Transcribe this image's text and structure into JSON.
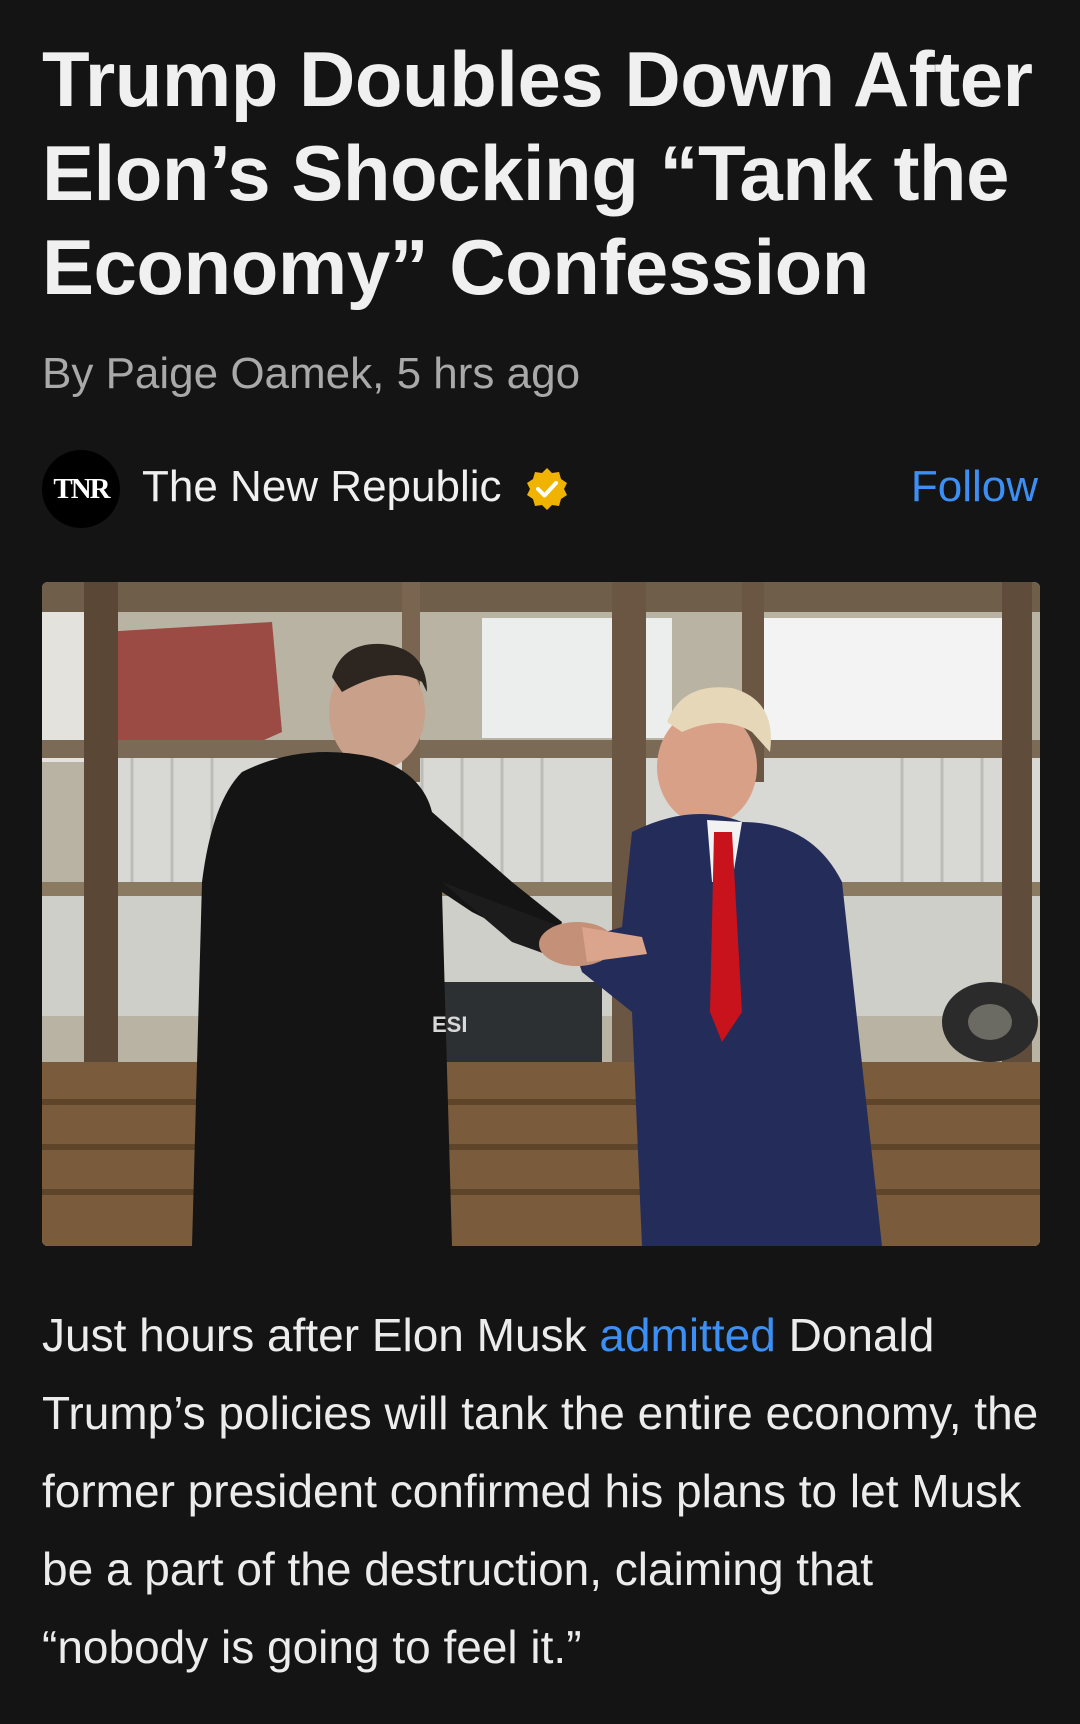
{
  "article": {
    "headline": "Trump Doubles Down After Elon’s Shocking “Tank the Economy” Confession",
    "byline": "By Paige Oamek, 5 hrs ago",
    "publisher": {
      "logo_text": "TNR",
      "name": "The New Republic",
      "verified_icon": "verified-badge-icon",
      "follow_label": "Follow"
    },
    "image": {
      "sign_text": "ESI"
    },
    "body": {
      "text_before_link": "Just hours after Elon Musk ",
      "link_text": "admitted",
      "text_after_link": " Donald Trump’s policies will tank the entire economy, the former president confirmed his plans to let Musk be a part of the destruction, claiming that “nobody is going to feel it.”"
    }
  },
  "colors": {
    "background": "#141414",
    "text": "#eeeeee",
    "byline": "#a9a9a9",
    "link": "#3b8ff5",
    "verified_badge": "#f0b400"
  }
}
